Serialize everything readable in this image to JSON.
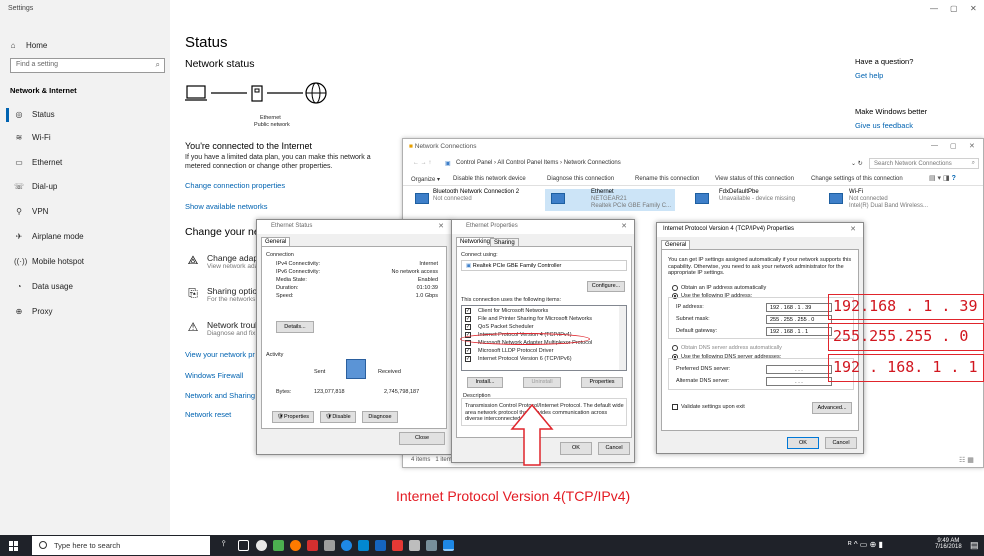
{
  "settings": {
    "window_title": "Settings",
    "sidebar": {
      "home": "Home",
      "search_placeholder": "Find a setting",
      "section": "Network & Internet",
      "items": [
        {
          "label": "Status",
          "icon": "globe-icon"
        },
        {
          "label": "Wi-Fi",
          "icon": "wifi-icon"
        },
        {
          "label": "Ethernet",
          "icon": "ethernet-icon"
        },
        {
          "label": "Dial-up",
          "icon": "dialup-icon"
        },
        {
          "label": "VPN",
          "icon": "vpn-icon"
        },
        {
          "label": "Airplane mode",
          "icon": "airplane-icon"
        },
        {
          "label": "Mobile hotspot",
          "icon": "hotspot-icon"
        },
        {
          "label": "Data usage",
          "icon": "data-usage-icon"
        },
        {
          "label": "Proxy",
          "icon": "proxy-icon"
        }
      ]
    },
    "main": {
      "title": "Status",
      "network_status": "Network status",
      "diagram_ethernet": "Ethernet",
      "diagram_public": "Public network",
      "connected": "You're connected to the Internet",
      "limited_plan": "If you have a limited data plan, you can make this network a metered connection or change other properties.",
      "change_props": "Change connection properties",
      "show_networks": "Show available networks",
      "change_your": "Change your ne",
      "adapter_opt": {
        "title": "Change adapter",
        "desc": "View network adap"
      },
      "sharing_opt": {
        "title": "Sharing options",
        "desc": "For the networks y"
      },
      "trouble_opt": {
        "title": "Network trouble",
        "desc": "Diagnose and fix p"
      },
      "view_props": "View your network pr",
      "firewall": "Windows Firewall",
      "sharing_center": "Network and Sharing",
      "reset": "Network reset"
    },
    "right": {
      "question": "Have a question?",
      "help": "Get help",
      "better": "Make Windows better",
      "feedback": "Give us feedback"
    }
  },
  "explorer": {
    "title": "Network Connections",
    "breadcrumb": "Control Panel  ›  All Control Panel Items  ›  Network Connections",
    "search_placeholder": "Search Network Connections",
    "cmd": {
      "organize": "Organize ▾",
      "disable": "Disable this network device",
      "diagnose": "Diagnose this connection",
      "rename": "Rename this connection",
      "view_status": "View status of this connection",
      "change_settings": "Change settings of this connection"
    },
    "adapters": [
      {
        "name": "Bluetooth Network Connection 2",
        "status": "Not connected",
        "device": "Bluetooth Device (Personal Area ..."
      },
      {
        "name": "Ethernet",
        "status": "NETGEAR21",
        "device": "Realtek PCIe GBE Family C..."
      },
      {
        "name": "FdxDefaultPbe",
        "status": "Unavailable - device missing",
        "device": ""
      },
      {
        "name": "Wi-Fi",
        "status": "Not connected",
        "device": "Intel(R) Dual Band Wireless..."
      }
    ],
    "footer_items": "4 items",
    "footer_selected": "1 item selected"
  },
  "eth_status": {
    "title": "Ethernet Status",
    "tab": "General",
    "connection": "Connection",
    "rows": [
      {
        "label": "IPv4 Connectivity:",
        "value": "Internet"
      },
      {
        "label": "IPv6 Connectivity:",
        "value": "No network access"
      },
      {
        "label": "Media State:",
        "value": "Enabled"
      },
      {
        "label": "Duration:",
        "value": "01:10:39"
      },
      {
        "label": "Speed:",
        "value": "1.0 Gbps"
      }
    ],
    "details": "Details...",
    "activity": "Activity",
    "sent": "Sent",
    "received": "Received",
    "bytes_label": "Bytes:",
    "bytes_sent": "123,077,818",
    "bytes_received": "2,745,798,187",
    "properties": "Properties",
    "disable": "Disable",
    "diagnose": "Diagnose",
    "close": "Close"
  },
  "eth_props": {
    "title": "Ethernet Properties",
    "tab_networking": "Networking",
    "tab_sharing": "Sharing",
    "connect_using": "Connect using:",
    "adapter": "Realtek PCIe GBE Family Controller",
    "configure": "Configure...",
    "items_label": "This connection uses the following items:",
    "items": [
      {
        "label": "Client for Microsoft Networks",
        "checked": true
      },
      {
        "label": "File and Printer Sharing for Microsoft Networks",
        "checked": true
      },
      {
        "label": "QoS Packet Scheduler",
        "checked": true
      },
      {
        "label": "Internet Protocol Version 4 (TCP/IPv4)",
        "checked": true
      },
      {
        "label": "Microsoft Network Adapter Multiplexor Protocol",
        "checked": false
      },
      {
        "label": "Microsoft LLDP Protocol Driver",
        "checked": true
      },
      {
        "label": "Internet Protocol Version 6 (TCP/IPv6)",
        "checked": true
      }
    ],
    "install": "Install...",
    "uninstall": "Uninstall",
    "properties": "Properties",
    "description_label": "Description",
    "description": "Transmission Control Protocol/Internet Protocol. The default wide area network protocol that provides communication across diverse interconnected networks.",
    "ok": "OK",
    "cancel": "Cancel"
  },
  "ipv4": {
    "title": "Internet Protocol Version 4 (TCP/IPv4) Properties",
    "tab": "General",
    "intro": "You can get IP settings assigned automatically if your network supports this capability. Otherwise, you need to ask your network administrator for the appropriate IP settings.",
    "obtain_auto": "Obtain an IP address automatically",
    "use_following": "Use the following IP address:",
    "ip_label": "IP address:",
    "ip_value": "192 . 168 .  1  . 39",
    "mask_label": "Subnet mask:",
    "mask_value": "255 . 255 . 255 . 0",
    "gw_label": "Default gateway:",
    "gw_value": "192 . 168 .  1  .  1",
    "dns_auto": "Obtain DNS server address automatically",
    "dns_use": "Use the following DNS server addresses:",
    "pref_dns": "Preferred DNS server:",
    "alt_dns": "Alternate DNS server:",
    "dns_blank": ".     .     .",
    "validate": "Validate settings upon exit",
    "advanced": "Advanced...",
    "ok": "OK",
    "cancel": "Cancel"
  },
  "overlay": {
    "ip": "192.168 . 1 . 39",
    "mask": "255.255.255 . 0",
    "gateway": "192  . 168. 1 . 1",
    "caption": "Internet Protocol Version 4(TCP/IPv4)"
  },
  "taskbar": {
    "search": "Type here to search",
    "time": "9:49 AM",
    "date": "7/16/2018"
  },
  "colors": {
    "accent": "#0063b1",
    "red": "#e31b23",
    "taskbar": "#1f2229"
  }
}
